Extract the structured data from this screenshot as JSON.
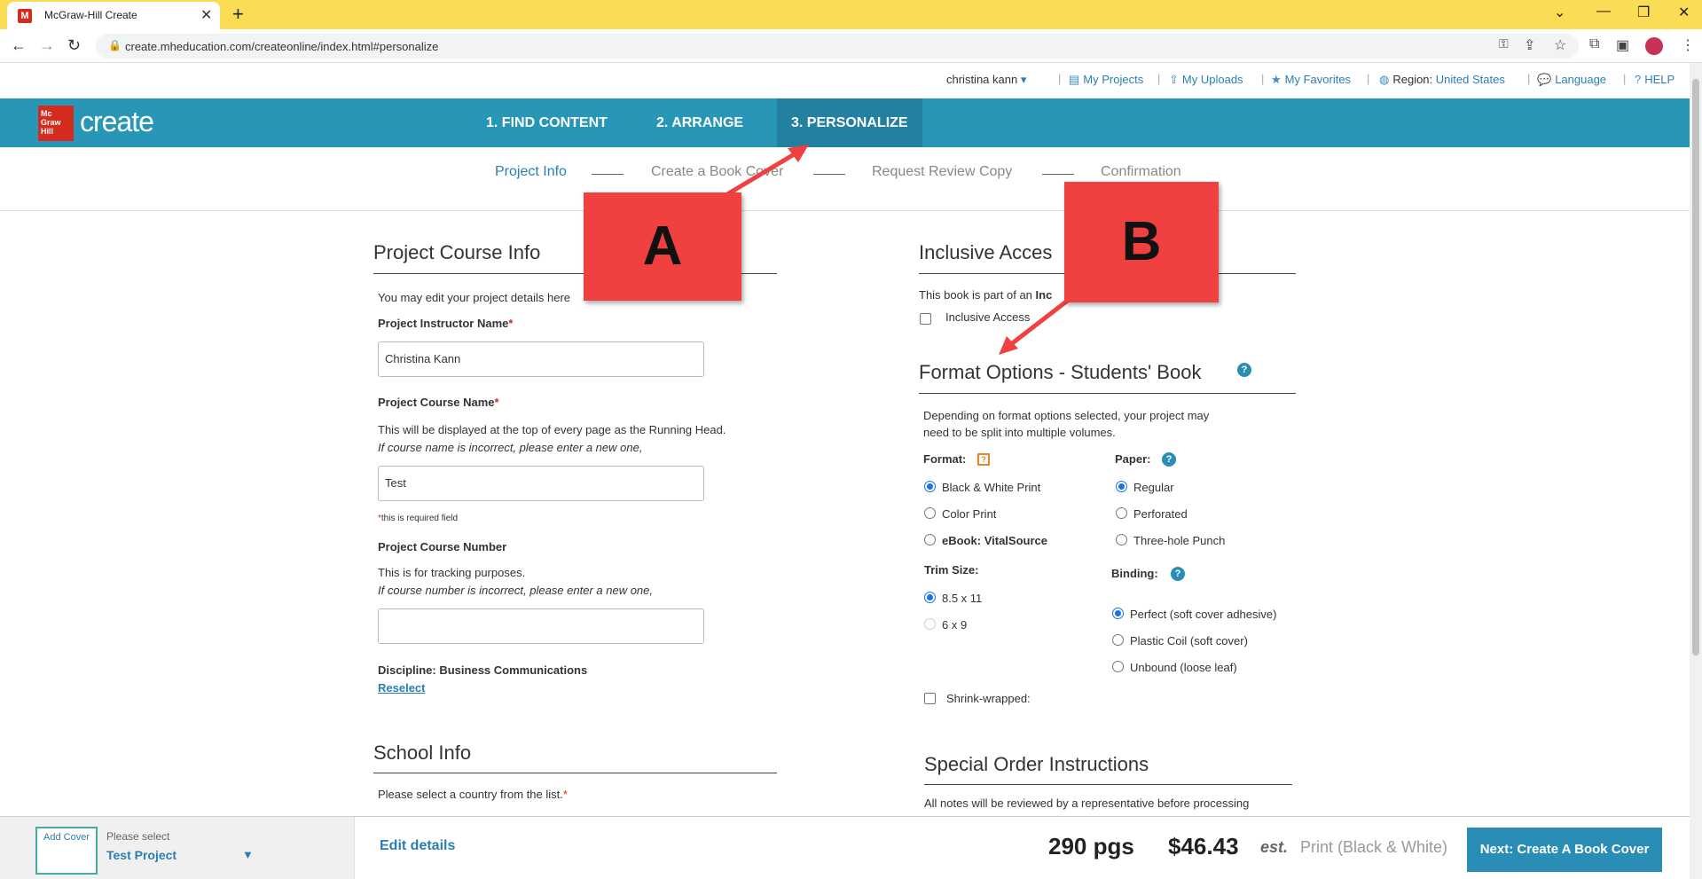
{
  "browser": {
    "tab_title": "McGraw-Hill Create",
    "tab_favicon": "M",
    "url": "create.mheducation.com/createonline/index.html#personalize"
  },
  "util": {
    "user": "christina kann",
    "my_projects": "My Projects",
    "my_uploads": "My Uploads",
    "my_favorites": "My Favorites",
    "region_label": "Region:",
    "region_value": "United States",
    "language": "Language",
    "help": "HELP"
  },
  "header": {
    "logo_text": "Mc Graw Hill",
    "brand": "create",
    "steps": [
      "1. FIND CONTENT",
      "2. ARRANGE",
      "3. PERSONALIZE"
    ]
  },
  "subnav": [
    "Project Info",
    "Create a Book Cover",
    "Request Review Copy",
    "Confirmation"
  ],
  "project_course_info": {
    "heading": "Project Course Info",
    "intro": "You may edit your project details here",
    "instructor_label": "Project Instructor Name",
    "instructor_value": "Christina Kann",
    "course_name_label": "Project Course Name",
    "course_name_help": "This will be displayed at the top of every page as the Running Head.",
    "course_name_help2": "If course name is incorrect, please enter a new one,",
    "course_name_value": "Test",
    "required_note": "this is required field",
    "course_number_label": "Project Course Number",
    "course_number_help": "This is for tracking purposes.",
    "course_number_help2": "If course number is incorrect, please enter a new one,",
    "course_number_value": "",
    "discipline": "Discipline: Business Communications",
    "reselect": "Reselect"
  },
  "school_info": {
    "heading": "School Info",
    "country_prompt": "Please select a country from the list."
  },
  "inclusive_access": {
    "heading": "Inclusive Acces",
    "text_prefix": "This book is part of an",
    "text_bold": "Inc",
    "checkbox_label": "Inclusive Access"
  },
  "format_options": {
    "heading": "Format Options - Students' Book",
    "desc1": "Depending on format options selected, your project may",
    "desc2": "need to be split into multiple volumes.",
    "format_label": "Format:",
    "format_options": [
      "Black & White Print",
      "Color Print"
    ],
    "ebook_prefix": "eBook:",
    "ebook_bold": "VitalSource",
    "paper_label": "Paper:",
    "paper_options": [
      "Regular",
      "Perforated",
      "Three-hole Punch"
    ],
    "trim_label": "Trim Size:",
    "trim_options": [
      "8.5 x 11",
      "6 x 9"
    ],
    "binding_label": "Binding:",
    "binding_options": [
      "Perfect (soft cover adhesive)",
      "Plastic Coil (soft cover)",
      "Unbound (loose leaf)"
    ],
    "shrink_label": "Shrink-wrapped:"
  },
  "special_order": {
    "heading": "Special Order Instructions",
    "note": "All notes will be reviewed by a representative before processing"
  },
  "annotations": {
    "a": "A",
    "b": "B"
  },
  "bottom": {
    "add_cover": "Add Cover",
    "please_select": "Please select",
    "project_name": "Test Project",
    "edit_details": "Edit details",
    "pages": "290 pgs",
    "price": "$46.43",
    "est": "est.",
    "format": "Print (Black & White)",
    "next": "Next: Create A Book Cover"
  },
  "colors": {
    "nav": "#2896b7",
    "accent": "#2a7fb2",
    "callout": "#f04040",
    "tabbar": "#fadc55"
  },
  "icons": [
    "back-arrow-icon",
    "forward-arrow-icon",
    "reload-icon",
    "lock-icon",
    "key-icon",
    "share-icon",
    "star-icon",
    "extensions-icon",
    "sidebar-icon",
    "menu-icon",
    "help-icon",
    "globe-icon",
    "chat-icon",
    "upload-icon",
    "folder-icon",
    "caret-down-icon"
  ]
}
